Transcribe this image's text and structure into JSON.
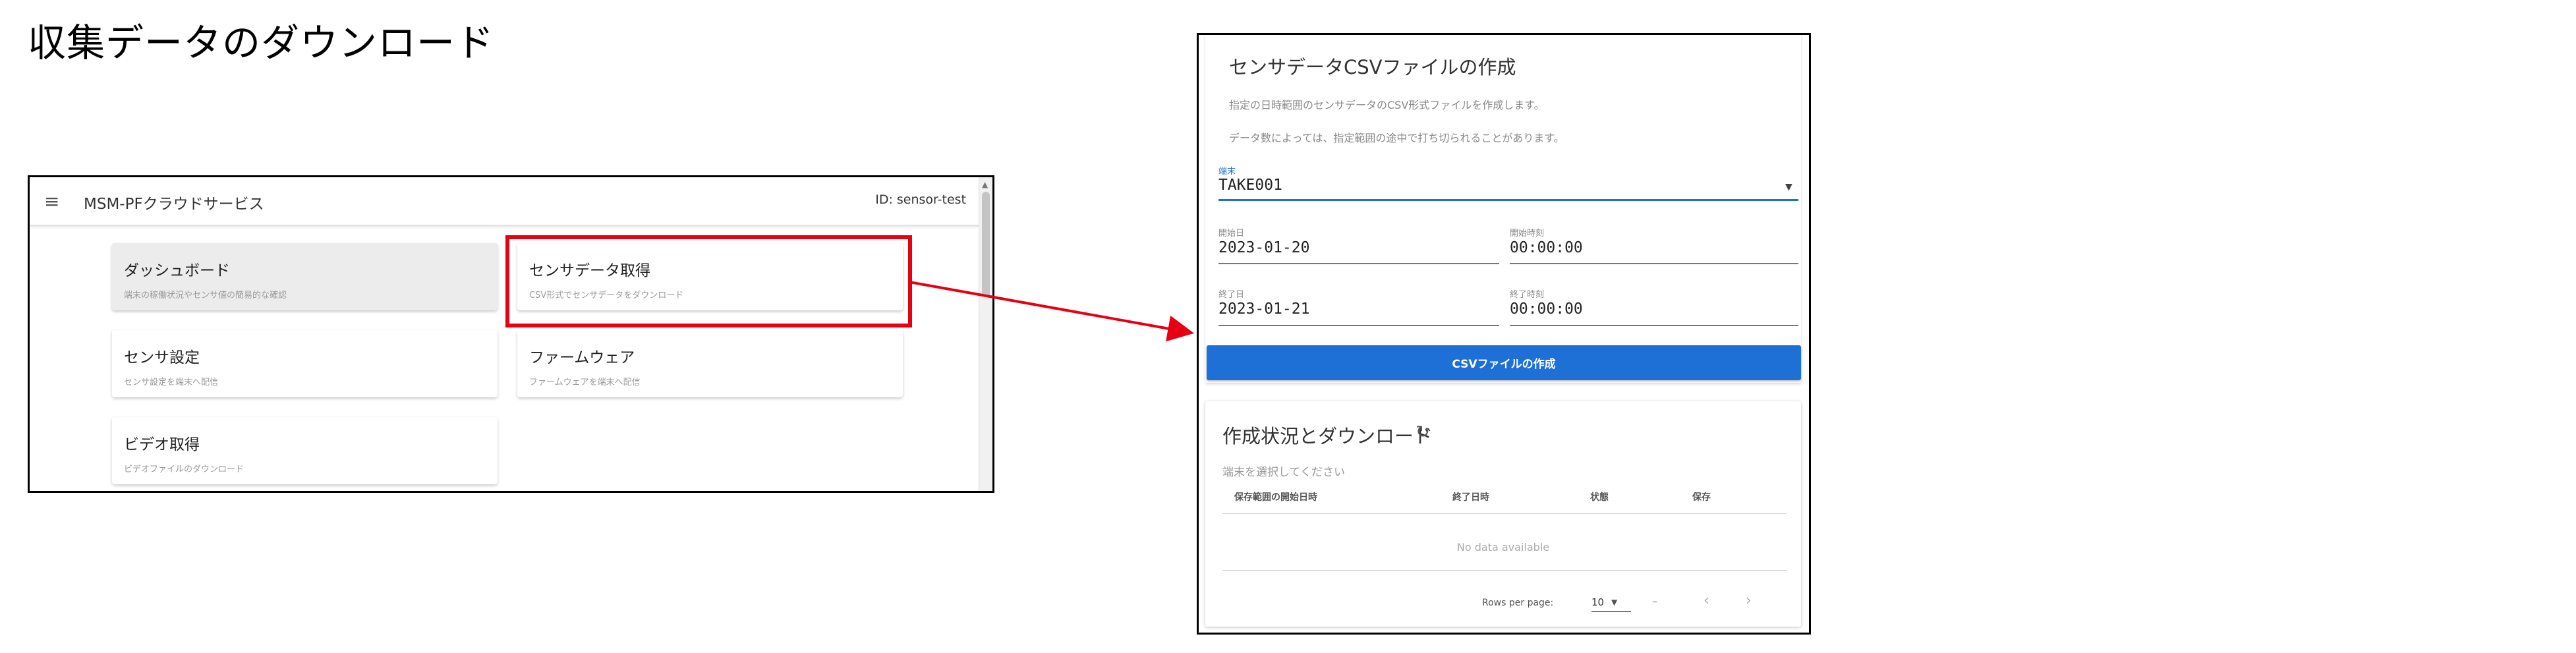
{
  "slide": {
    "title": "収集データのダウンロード"
  },
  "dashboard": {
    "menu_icon": "≡",
    "service_name": "MSM-PFクラウドサービス",
    "user_id": "ID: sensor-test",
    "cards": [
      {
        "title": "ダッシュボード",
        "subtitle": "端末の稼働状況やセンサ値の簡易的な確認"
      },
      {
        "title": "センサデータ取得",
        "subtitle": "CSV形式でセンサデータをダウンロード"
      },
      {
        "title": "センサ設定",
        "subtitle": "センサ設定を端末へ配信"
      },
      {
        "title": "ファームウェア",
        "subtitle": "ファームウェアを端末へ配信"
      },
      {
        "title": "ビデオ取得",
        "subtitle": "ビデオファイルのダウンロード"
      }
    ]
  },
  "csv_form": {
    "title": "センサデータCSVファイルの作成",
    "description_1": "指定の日時範囲のセンサデータのCSV形式ファイルを作成します。",
    "description_2": "データ数によっては、指定範囲の途中で打ち切られることがあります。",
    "terminal": {
      "label": "端末",
      "value": "TAKE001"
    },
    "start_date": {
      "label": "開始日",
      "value": "2023-01-20"
    },
    "start_time": {
      "label": "開始時刻",
      "value": "00:00:00"
    },
    "end_date": {
      "label": "終了日",
      "value": "2023-01-21"
    },
    "end_time": {
      "label": "終了時刻",
      "value": "00:00:00"
    },
    "create_button": "CSVファイルの作成"
  },
  "status": {
    "title": "作成状況とダウンロード",
    "hint": "端末を選択してください",
    "columns": [
      "保存範囲の開始日時",
      "終了日時",
      "状態",
      "保存"
    ],
    "empty_message": "No data available",
    "rows_per_page_label": "Rows per page:",
    "rows_per_page_value": "10",
    "page_range": "–"
  },
  "colors": {
    "highlight": "#e60012",
    "accent": "#1e6fd6"
  },
  "icons": [
    "menu-icon",
    "refresh-icon",
    "dropdown-caret-icon",
    "chevron-left-icon",
    "chevron-right-icon",
    "arrow-icon"
  ]
}
